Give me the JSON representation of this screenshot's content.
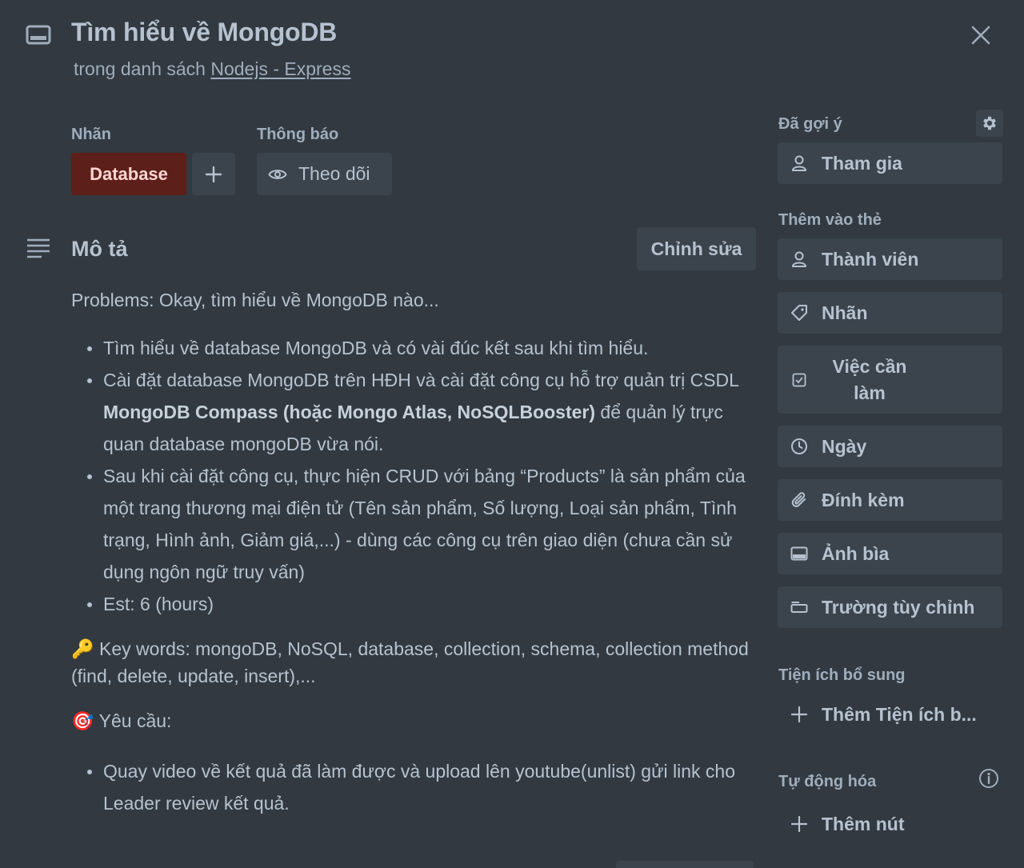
{
  "card": {
    "title": "Tìm hiểu về MongoDB",
    "list_prefix": "trong danh sách",
    "list_name": "Nodejs - Express"
  },
  "labels": {
    "heading": "Nhãn",
    "items": [
      {
        "text": "Database",
        "color": "#5d1f1a"
      }
    ]
  },
  "notifications": {
    "heading": "Thông báo",
    "watch_label": "Theo dõi"
  },
  "description": {
    "heading": "Mô tả",
    "edit_label": "Chỉnh sửa",
    "intro": "Problems: Okay, tìm hiểu về MongoDB nào...",
    "bullets": {
      "b1": "Tìm hiểu về database MongoDB và có vài đúc kết sau khi tìm hiểu.",
      "b2_pre": "Cài đặt database MongoDB trên HĐH và cài đặt công cụ hỗ trợ quản trị CSDL ",
      "b2_bold": "MongoDB Compass (hoặc Mongo Atlas, NoSQLBooster)",
      "b2_post": " để quản lý trực quan database mongoDB vừa nói.",
      "b3": "Sau khi cài đặt công cụ, thực hiện CRUD với bảng “Products” là sản phẩm của một trang thương mại điện tử (Tên sản phẩm, Số lượng, Loại sản phẩm, Tình trạng, Hình ảnh, Giảm giá,...) - dùng các công cụ trên giao diện (chưa cần sử dụng ngôn ngữ truy vấn)",
      "b4": "Est: 6 (hours)"
    },
    "keywords_emoji": "🔑",
    "keywords": "Key words: mongoDB, NoSQL, database, collection, schema, collection method (find, delete, update, insert),...",
    "requirements_emoji": "🎯",
    "requirements_heading": "Yêu cầu:",
    "requirement_1": "Quay video về kết quả đã làm được và upload lên youtube(unlist) gửi link cho Leader review kết quả."
  },
  "sidebar": {
    "suggested": {
      "heading": "Đã gợi ý",
      "join_label": "Tham gia"
    },
    "add_to_card": {
      "heading": "Thêm vào thẻ",
      "members": "Thành viên",
      "labels": "Nhãn",
      "checklist": "Việc cần làm",
      "dates": "Ngày",
      "attachment": "Đính kèm",
      "cover": "Ảnh bìa",
      "custom_fields": "Trường tùy chỉnh"
    },
    "powerups": {
      "heading": "Tiện ích bổ sung",
      "add_label": "Thêm Tiện ích b..."
    },
    "automation": {
      "heading": "Tự động hóa",
      "add_button_label": "Thêm nút"
    }
  }
}
